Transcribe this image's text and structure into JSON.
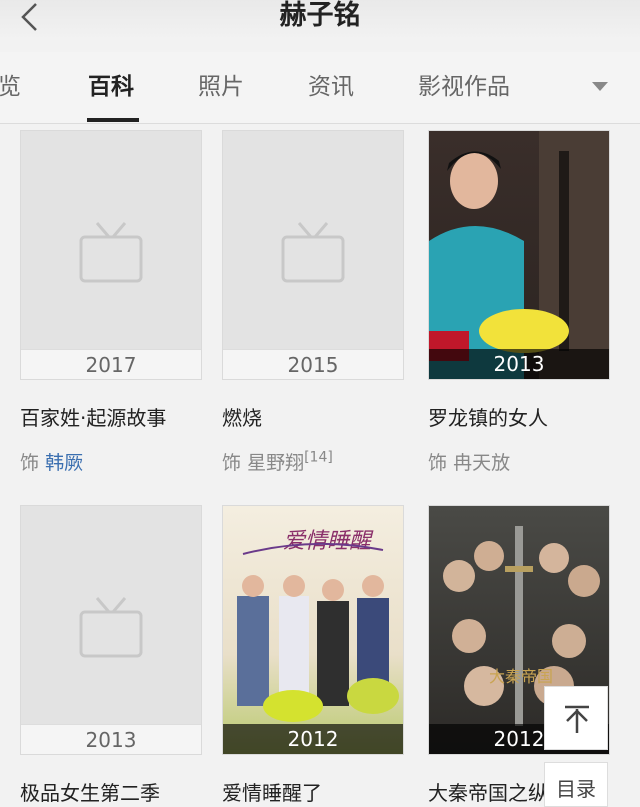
{
  "header": {
    "title": "赫子铭"
  },
  "tabs": [
    {
      "label": "览"
    },
    {
      "label": "百科"
    },
    {
      "label": "照片"
    },
    {
      "label": "资讯"
    },
    {
      "label": "影视作品"
    }
  ],
  "works": [
    {
      "year": "2017",
      "title": "百家姓·起源故事",
      "role_prefix": "饰",
      "role": "韩厥",
      "role_is_link": true,
      "note": ""
    },
    {
      "year": "2015",
      "title": "燃烧",
      "role_prefix": "饰",
      "role": "星野翔",
      "role_is_link": false,
      "note": "[14]"
    },
    {
      "year": "2013",
      "title": "罗龙镇的女人",
      "role_prefix": "饰",
      "role": "冉天放",
      "role_is_link": false,
      "note": ""
    },
    {
      "year": "2013",
      "title": "极品女生第二季"
    },
    {
      "year": "2012",
      "title": "爱情睡醒了",
      "poster_text": "爱情睡醒"
    },
    {
      "year": "2012",
      "title": "大秦帝国之纵"
    }
  ],
  "float_buttons": {
    "top_label": "个",
    "toc_label": "目录"
  },
  "colors": {
    "link": "#3b6fb0",
    "tab_active": "#222222"
  }
}
